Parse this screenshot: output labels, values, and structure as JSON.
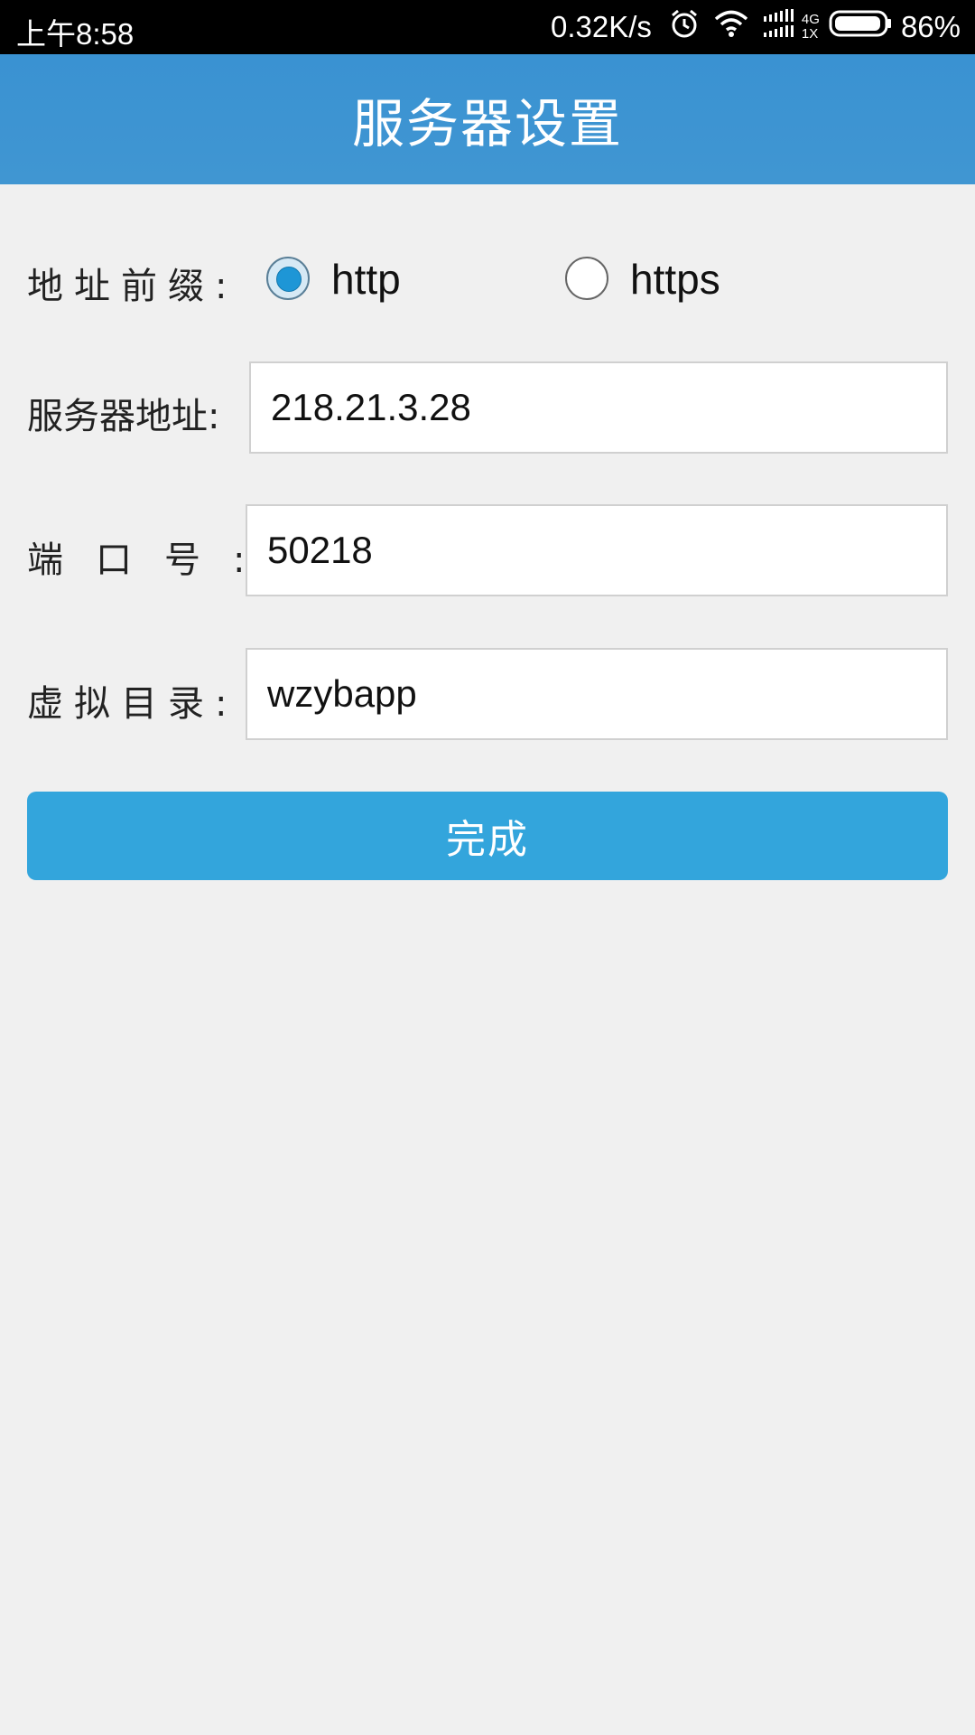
{
  "status_bar": {
    "time": "上午8:58",
    "net_speed": "0.32K/s",
    "network_top": "4G",
    "network_bottom": "1X",
    "battery": "86%",
    "icons": [
      "alarm-icon",
      "wifi-icon",
      "signal-icon",
      "battery-icon"
    ]
  },
  "header": {
    "title": "服务器设置"
  },
  "form": {
    "prefix_label": "地址前缀:",
    "prefix_options": [
      {
        "label": "http",
        "checked": true
      },
      {
        "label": "https",
        "checked": false
      }
    ],
    "server_label": "服务器地址:",
    "server_value": "218.21.3.28",
    "port_label": "端口号:",
    "port_value": "50218",
    "dir_label": "虚拟目录:",
    "dir_value": "wzybapp",
    "submit_label": "完成"
  },
  "colors": {
    "header": "#3a92d2",
    "button": "#33a5dc",
    "background": "#f0f0f0",
    "radio_dot": "#1e96d6"
  }
}
